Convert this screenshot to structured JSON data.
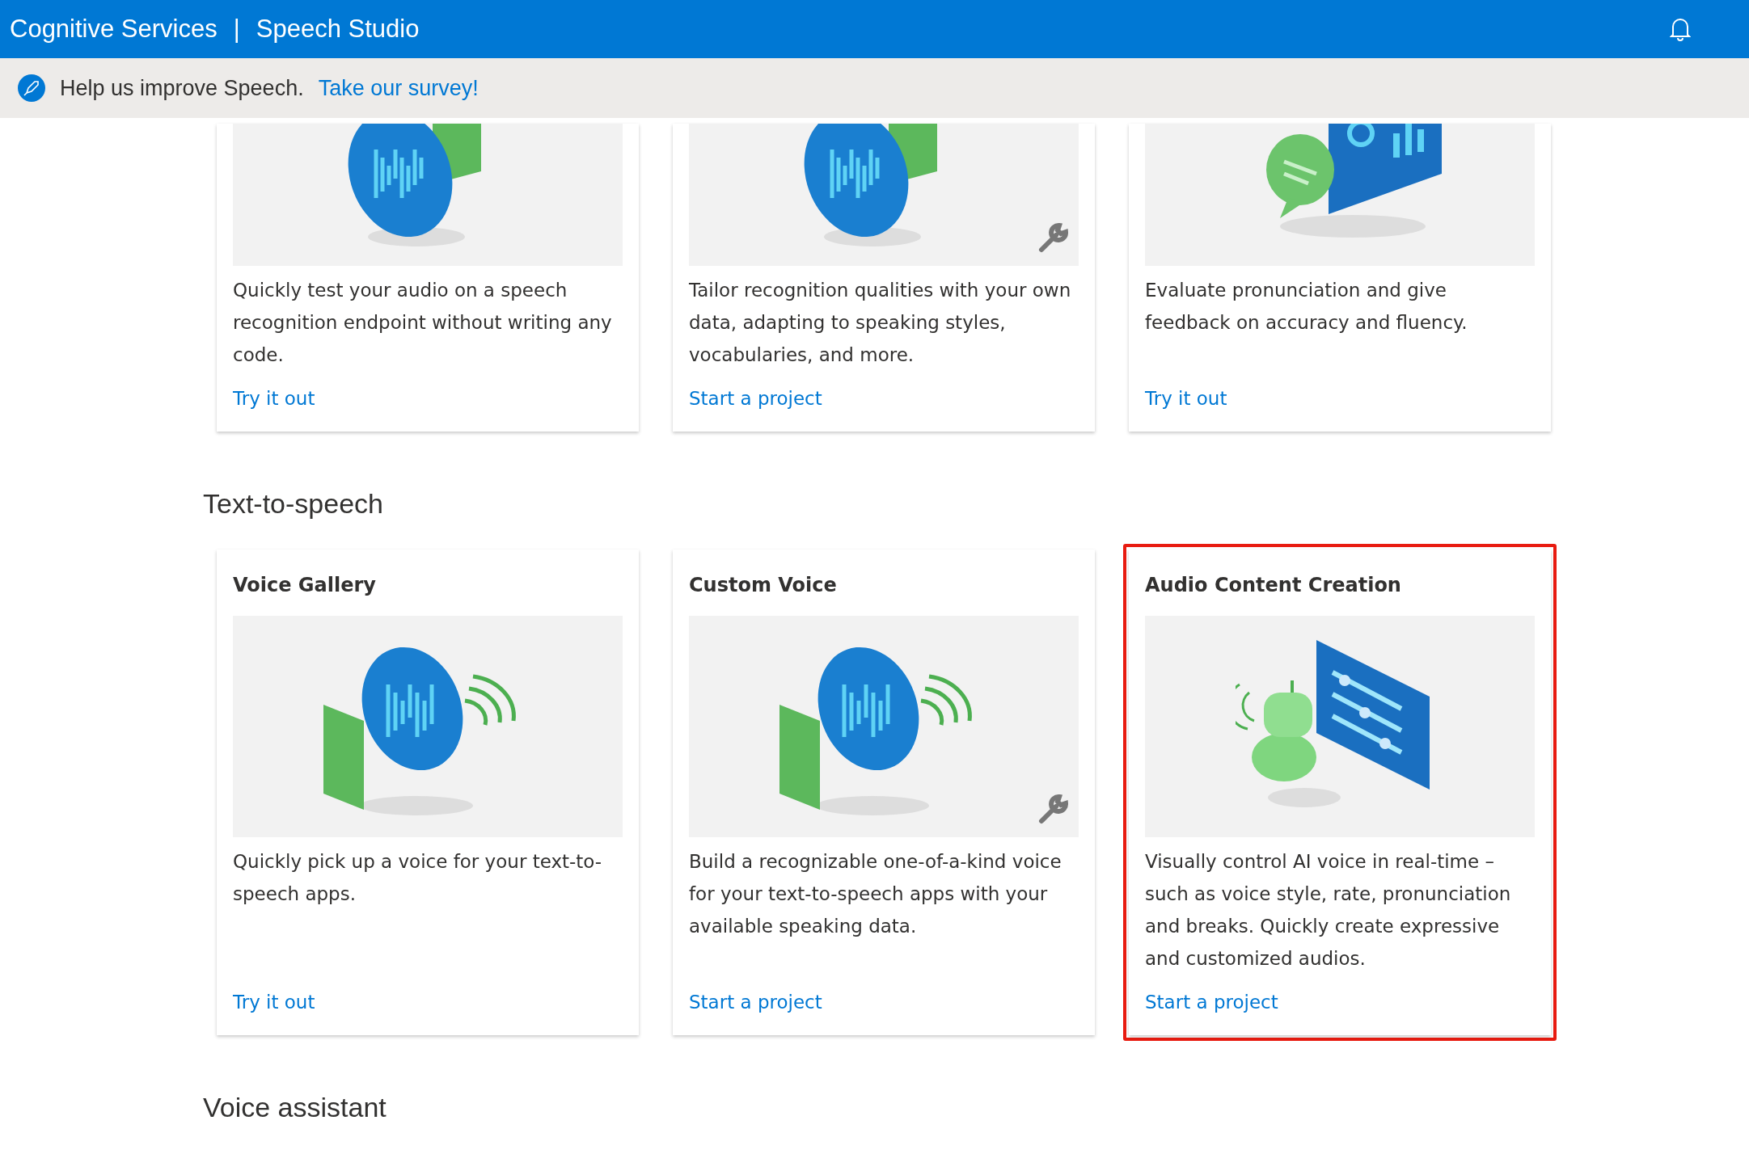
{
  "header": {
    "brand": "Cognitive Services",
    "separator": "|",
    "product": "Speech Studio"
  },
  "banner": {
    "message": "Help us improve Speech.",
    "link": "Take our survey!"
  },
  "sections": [
    {
      "cards": [
        {
          "kind": "speech",
          "wrench": false,
          "highlighted": false,
          "description": "Quickly test your audio on a speech recognition endpoint without writing any code.",
          "link": "Try it out"
        },
        {
          "kind": "speech",
          "wrench": true,
          "highlighted": false,
          "description": "Tailor recognition qualities with your own data, adapting to speaking styles, vocabularies, and more.",
          "link": "Start a project"
        },
        {
          "kind": "analytics",
          "wrench": false,
          "highlighted": false,
          "description": "Evaluate pronunciation and give feedback on accuracy and fluency.",
          "link": "Try it out"
        }
      ]
    },
    {
      "heading": "Text-to-speech",
      "cards": [
        {
          "title": "Voice Gallery",
          "kind": "voice",
          "wrench": false,
          "highlighted": false,
          "description": "Quickly pick up a voice for your text-to-speech apps.",
          "link": "Try it out"
        },
        {
          "title": "Custom Voice",
          "kind": "voice",
          "wrench": true,
          "highlighted": false,
          "description": "Build a recognizable one-of-a-kind voice for your text-to-speech apps with your available speaking data.",
          "link": "Start a project"
        },
        {
          "title": "Audio Content Creation",
          "kind": "robot",
          "wrench": false,
          "highlighted": true,
          "description": "Visually control AI voice in real-time – such as voice style, rate, pronunciation and breaks. Quickly create expressive and customized audios.",
          "link": "Start a project"
        }
      ]
    },
    {
      "heading": "Voice assistant"
    }
  ]
}
